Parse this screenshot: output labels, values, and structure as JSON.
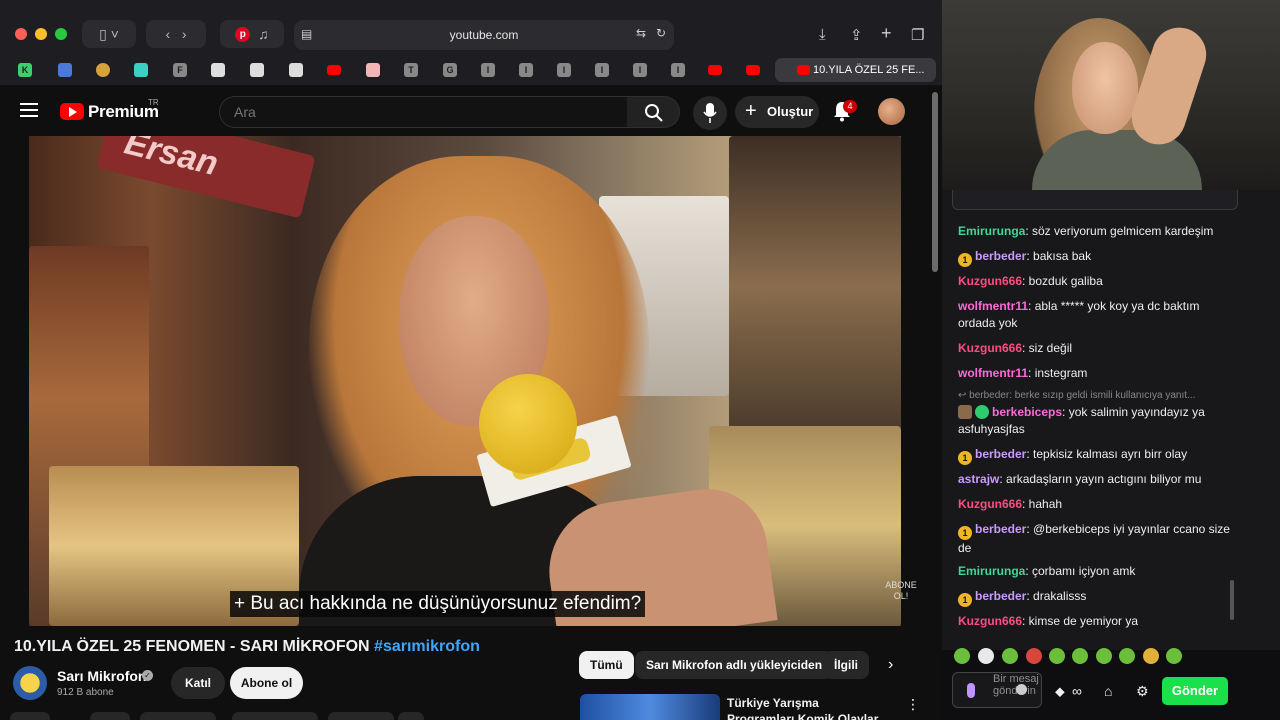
{
  "browser": {
    "address": "youtube.com",
    "active_tab": "10.YILA ÖZEL 25 FE...",
    "bookmarks": [
      "K",
      "F",
      "T",
      "G",
      "I",
      "I",
      "I",
      "I",
      "I",
      "I"
    ]
  },
  "header": {
    "brand": "Premium",
    "region": "TR",
    "search_placeholder": "Ara",
    "create_label": "Oluştur",
    "notification_count": "4"
  },
  "video": {
    "subtitle": "+ Bu acı hakkında ne düşünüyorsunuz efendim?",
    "watermark_line1": "ABONE",
    "watermark_line2": "OL!",
    "sign_text": "Ersan"
  },
  "info": {
    "title": "10.YILA ÖZEL 25 FENOMEN - SARI MİKROFON",
    "hashtag": "#sarımikrofon",
    "channel": "Sarı Mikrofon",
    "subscribers": "912 B abone",
    "join_label": "Katıl",
    "subscribe_label": "Abone ol"
  },
  "related": {
    "chips": [
      "Tümü",
      "Sarı Mikrofon adlı yükleyiciden",
      "İlgili"
    ],
    "first_title": "Türkiye Yarışma Programları Komik Olaylar"
  },
  "chat": {
    "messages": [
      {
        "user": "Emirurunga",
        "color": "#41d796",
        "text": ": söz veriyorum gelmicem kardeşim"
      },
      {
        "user": "berbeder",
        "color": "#c99bff",
        "text": ": bakısa bak",
        "badge": "1"
      },
      {
        "user": "Kuzgun666",
        "color": "#ff4d83",
        "text": ": bozduk galiba"
      },
      {
        "user": "wolfmentr11",
        "color": "#ff6ad5",
        "text": ": abla ***** yok koy ya dc baktım ordada yok"
      },
      {
        "user": "Kuzgun666",
        "color": "#ff4d83",
        "text": ": siz değil"
      },
      {
        "user": "wolfmentr11",
        "color": "#ff6ad5",
        "text": ": instegram"
      },
      {
        "user": "berkebiceps",
        "color": "#ff6ad5",
        "text": ": yok salimin yayındayız ya asfuhyasjfas"
      },
      {
        "user": "berbeder",
        "color": "#c99bff",
        "text": ": tepkisiz kalması ayrı birr olay",
        "badge": "1"
      },
      {
        "user": "astrajw",
        "color": "#c99bff",
        "text": ": arkadaşların yayın actıgını biliyor mu"
      },
      {
        "user": "Kuzgun666",
        "color": "#ff4d83",
        "text": ": hahah"
      },
      {
        "user": "berbeder",
        "color": "#c99bff",
        "text": ": @berkebiceps iyi yayınlar ccano size de",
        "badge": "1"
      },
      {
        "user": "Emirurunga",
        "color": "#41d796",
        "text": ": çorbamı içiyon amk"
      },
      {
        "user": "berbeder",
        "color": "#c99bff",
        "text": ": drakalisss",
        "badge": "1"
      },
      {
        "user": "Kuzgun666",
        "color": "#ff4d83",
        "text": ": kimse de yemiyor ya"
      }
    ],
    "reply_context": "berbeder: berke sızıp geldi ismili kullanıcıya yanıt...",
    "input_placeholder": "Bir mesaj gönderin",
    "send_label": "Gönder"
  },
  "colors": {
    "youtube_red": "#ff0000",
    "link_blue": "#3ea6ff",
    "twitch_send": "#1ce04b",
    "sub_badge": "#f0b429"
  }
}
